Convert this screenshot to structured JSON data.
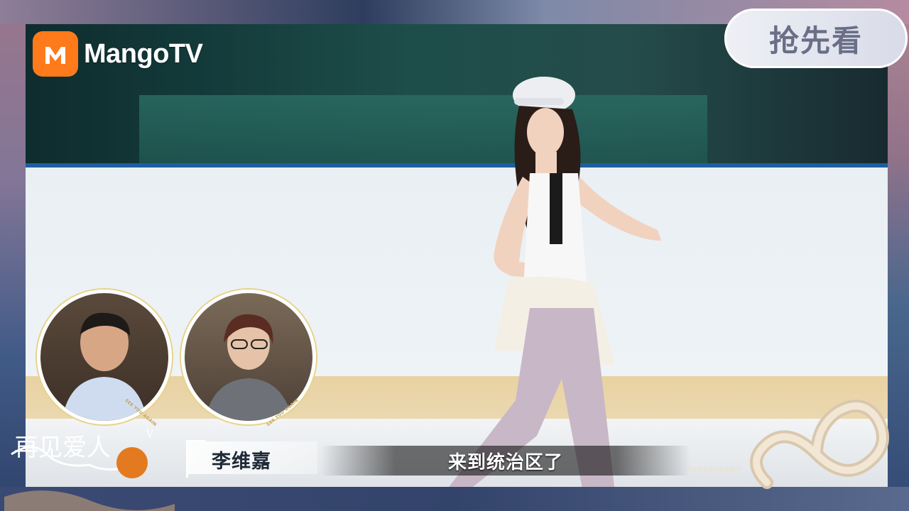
{
  "brand": {
    "name": "MangoTV",
    "accent": "#ff7a1a"
  },
  "badge": {
    "label": "抢先看"
  },
  "speaker": {
    "name": "李维嘉"
  },
  "subtitle": {
    "text": "来到统治区了"
  },
  "show": {
    "title": "再见爱人",
    "season": "V",
    "tagline": "SEE YOU AGAIN"
  },
  "guests": [
    {
      "id": "guest-1"
    },
    {
      "id": "guest-2"
    }
  ],
  "watermark": {
    "text": "Seeyouagain"
  }
}
